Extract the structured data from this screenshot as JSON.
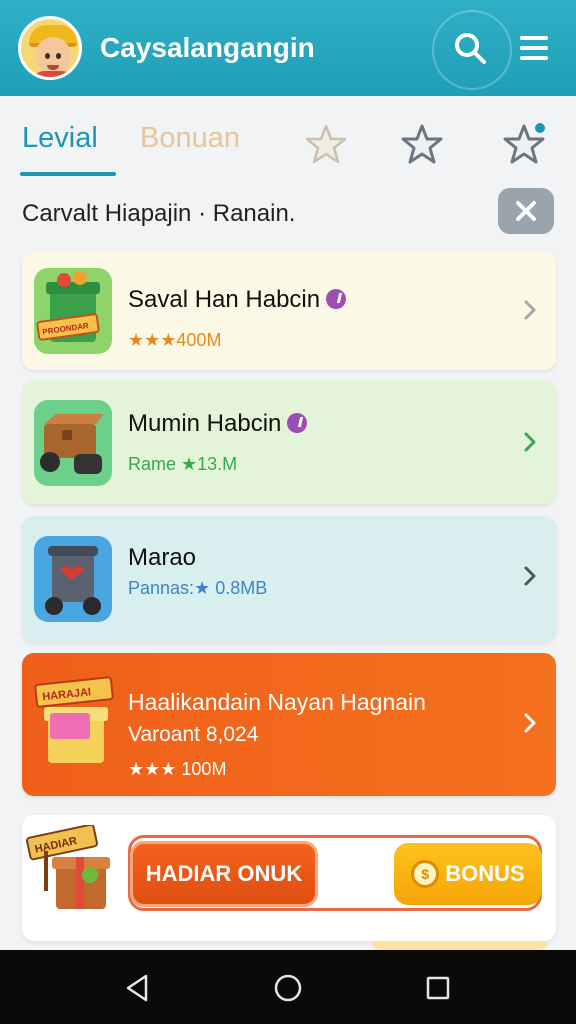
{
  "header": {
    "title": "Caysalangangin"
  },
  "tabs": {
    "level": "Levial",
    "bonus": "Bonuan"
  },
  "subheader": {
    "text": "Carvalt Hiapajin · Ranain."
  },
  "cards": [
    {
      "title": "Saval Han Habcin",
      "meta": "★★★400M",
      "verified": true
    },
    {
      "title": "Mumin Habcin",
      "meta": "Rame ★13.M",
      "verified": true
    },
    {
      "title": "Marao",
      "meta": "Pannas:★ 0.8MB",
      "verified": false
    },
    {
      "title": "Haalikandain Nayan Hagnain",
      "subtitle": "Varoant 8,024",
      "meta": "★★★ 100M"
    }
  ],
  "promo": {
    "left_label": "HADIAR ONUK",
    "right_label": "BONUS",
    "sign_text": "HADIAR"
  },
  "icon_labels": {
    "card1": "PROONDAR",
    "card4": "HARAJAI"
  },
  "colors": {
    "header": "#1f9fb6",
    "accent": "#1d97b0",
    "orange": "#f05f1a",
    "gold": "#f5a406"
  }
}
